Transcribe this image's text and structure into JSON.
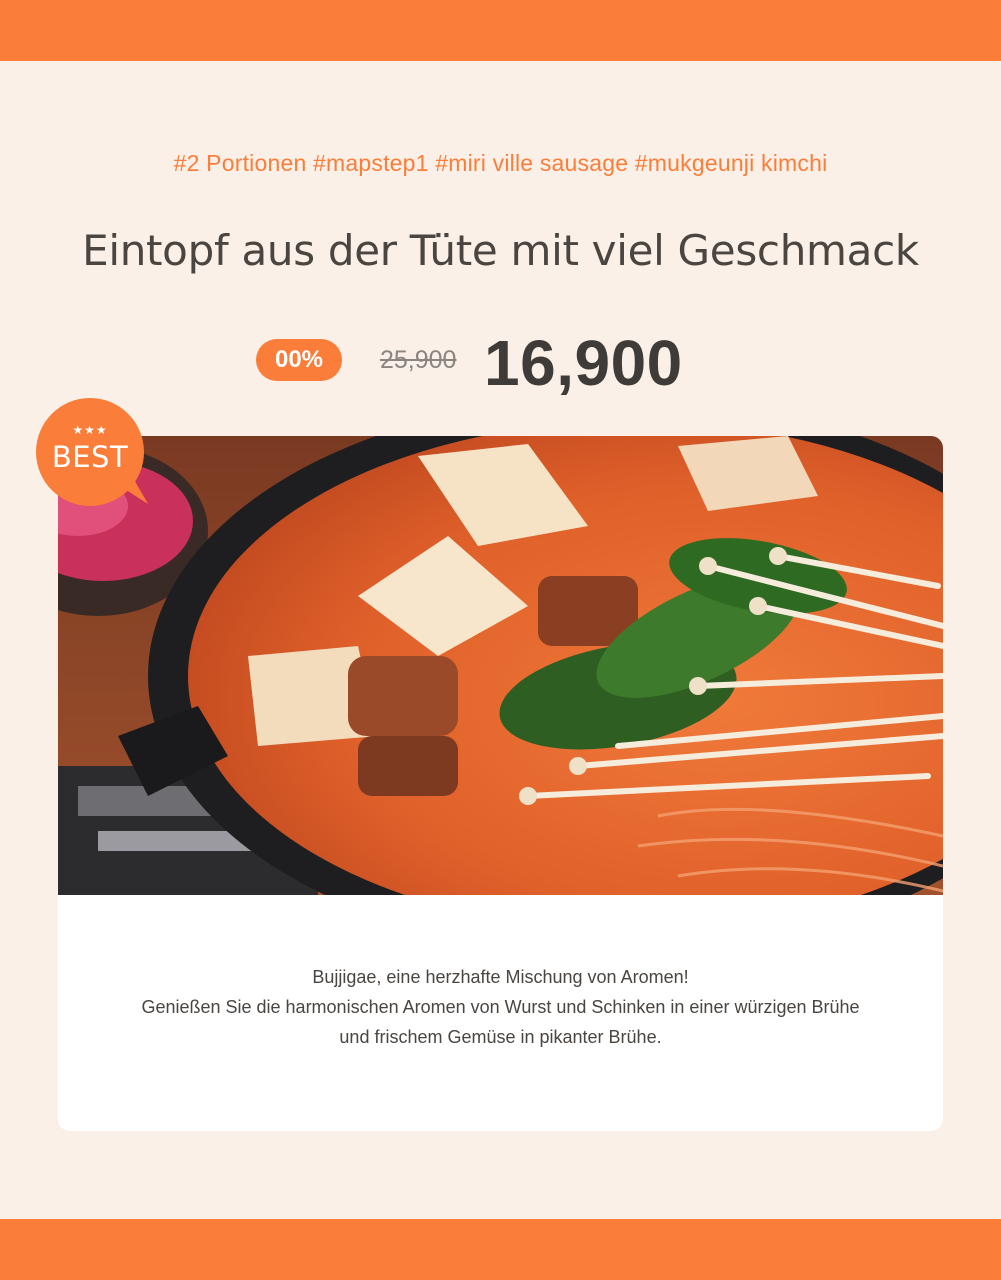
{
  "colors": {
    "accent": "#fb7d3a",
    "background": "#faf0e7",
    "card": "#ffffff",
    "title_text": "#4a4540",
    "price_text": "#3e3b38"
  },
  "tags": "#2 Portionen #mapstep1 #miri ville sausage #mukgeunji kimchi",
  "title": "Eintopf aus der Tüte mit viel Geschmack",
  "price": {
    "discount": "00%",
    "original": "25,900",
    "current": "16,900"
  },
  "badge": {
    "stars": "★★★",
    "label": "BEST"
  },
  "image": {
    "icon": "food-photo-icon"
  },
  "description": [
    "Bujjigae, eine herzhafte Mischung von Aromen!",
    "Genießen Sie die harmonischen Aromen von Wurst und Schinken in einer würzigen Brühe",
    "und frischem Gemüse in pikanter Brühe."
  ]
}
